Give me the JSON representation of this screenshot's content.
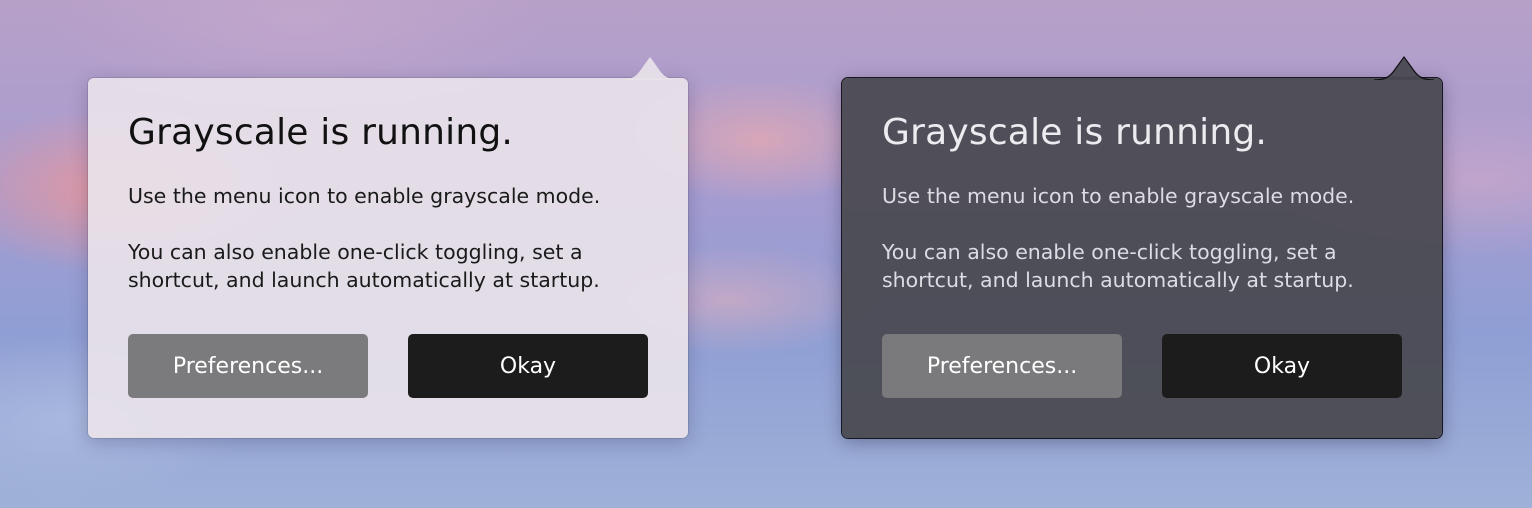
{
  "popovers": {
    "light": {
      "title": "Grayscale is running.",
      "paragraph1": "Use the menu icon to enable grayscale mode.",
      "paragraph2": "You can also enable one-click toggling, set a shortcut, and launch automatically at startup.",
      "preferences_label": "Preferences...",
      "okay_label": "Okay"
    },
    "dark": {
      "title": "Grayscale is running.",
      "paragraph1": "Use the menu icon to enable grayscale mode.",
      "paragraph2": "You can also enable one-click toggling, set a shortcut, and launch automatically at startup.",
      "preferences_label": "Preferences...",
      "okay_label": "Okay"
    }
  },
  "colors": {
    "light_panel": "#e8e2ea",
    "dark_panel": "#484850",
    "secondary_button": "#7b7b7d",
    "primary_button": "#1c1c1d"
  }
}
